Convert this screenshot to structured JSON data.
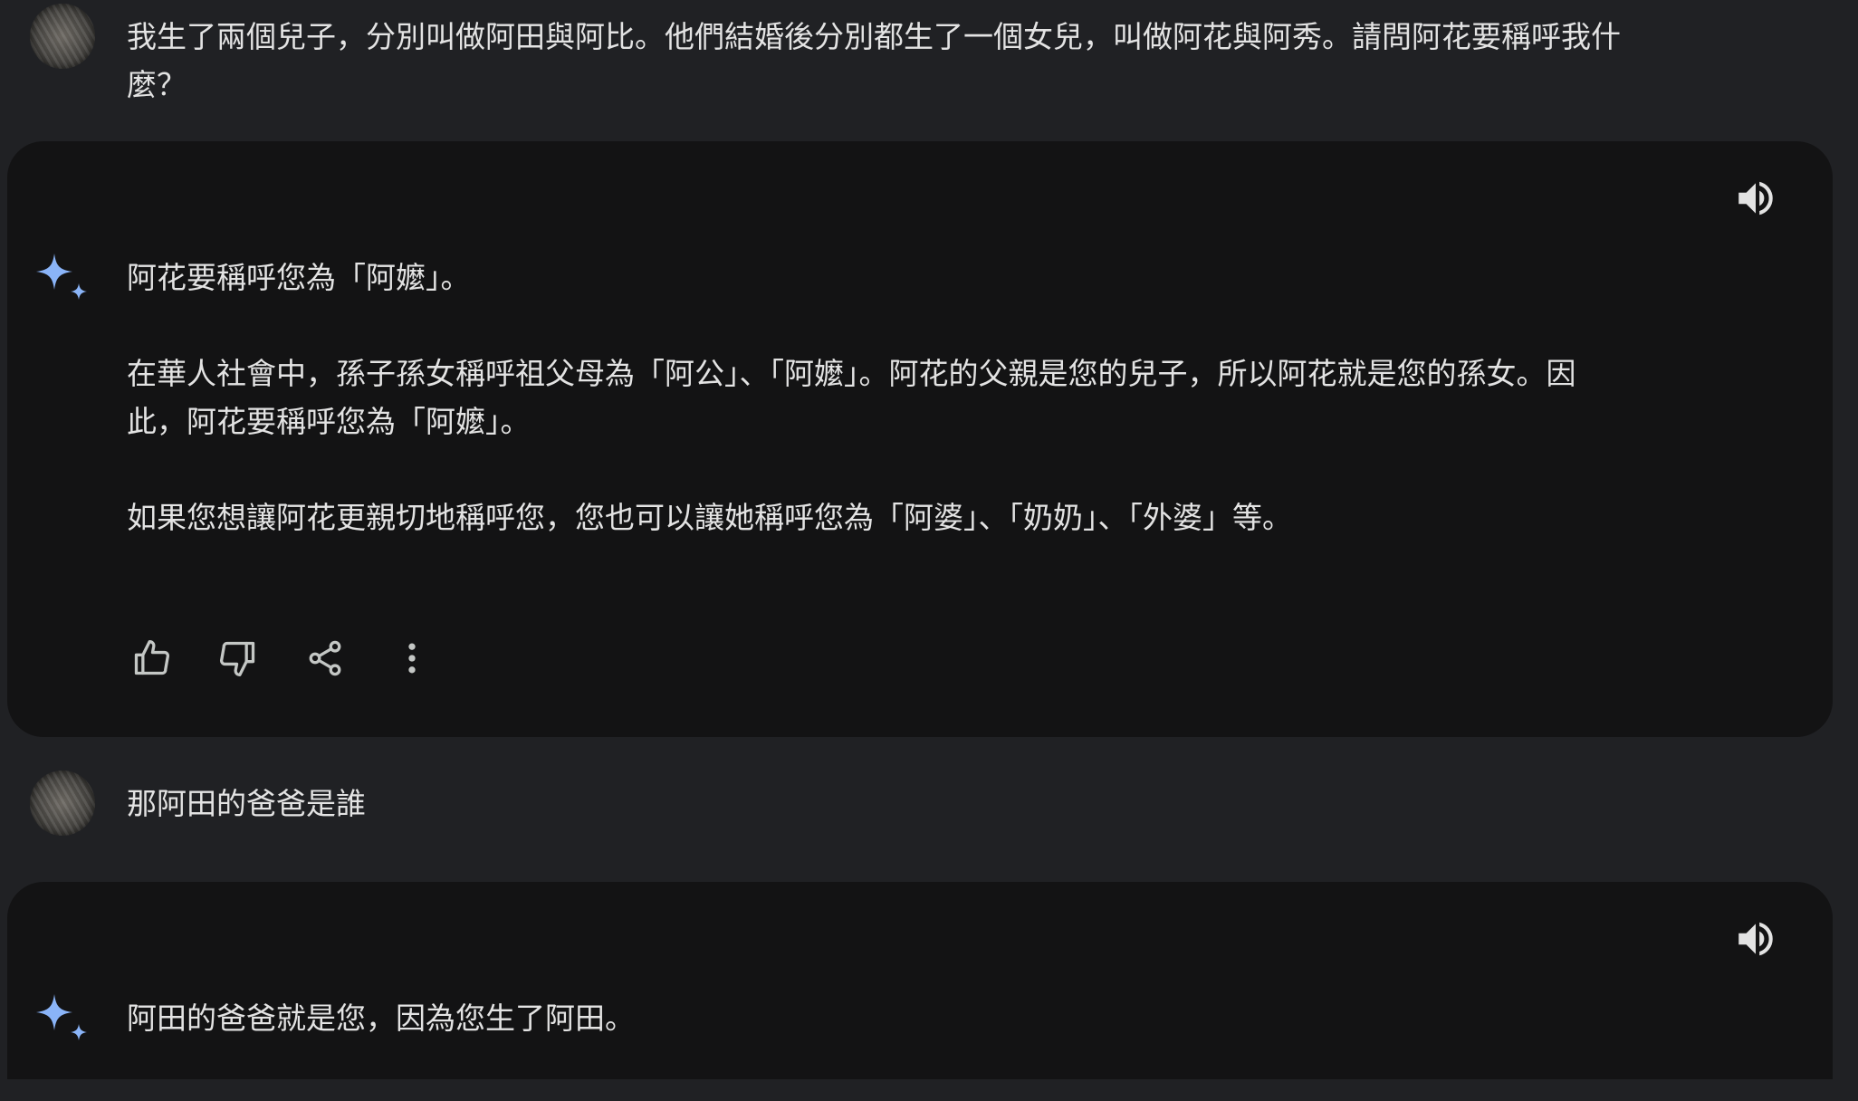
{
  "conversation": {
    "turn1": {
      "user": {
        "avatar_icon": "user-avatar",
        "line1": "我生了兩個兒子，分別叫做阿田與阿比。他們結婚後分別都生了一個女兒，叫做阿花與阿秀。請問阿花要稱呼我什",
        "line2": "麼？"
      },
      "response": {
        "icon": "gemini-sparkle-icon",
        "para1": "阿花要稱呼您為「阿嬤」。",
        "para2_line1": "在華人社會中，孫子孫女稱呼祖父母為「阿公」、「阿嬤」。阿花的父親是您的兒子，所以阿花就是您的孫女。因",
        "para2_line2": "此，阿花要稱呼您為「阿嬤」。",
        "para3": "如果您想讓阿花更親切地稱呼您，您也可以讓她稱呼您為「阿婆」、「奶奶」、「外婆」等。"
      }
    },
    "turn2": {
      "user": {
        "avatar_icon": "user-avatar",
        "text": "那阿田的爸爸是誰"
      },
      "response": {
        "icon": "gemini-sparkle-icon",
        "text": "阿田的爸爸就是您，因為您生了阿田。"
      }
    }
  },
  "actions": [
    "thumbs-up-icon",
    "thumbs-down-icon",
    "share-icon",
    "more-vert-icon"
  ],
  "colors": {
    "page_bg": "#202124",
    "card_bg": "#131314",
    "text": "#e3e3e3",
    "icon": "#c4c7c5",
    "sparkle": "#8ab4f8"
  }
}
